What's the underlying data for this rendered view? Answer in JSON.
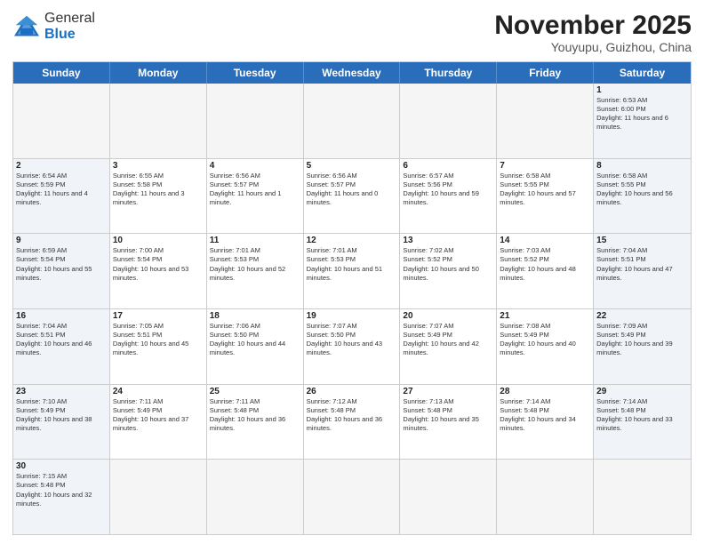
{
  "header": {
    "logo_general": "General",
    "logo_blue": "Blue",
    "month_title": "November 2025",
    "location": "Youyupu, Guizhou, China"
  },
  "calendar": {
    "days": [
      "Sunday",
      "Monday",
      "Tuesday",
      "Wednesday",
      "Thursday",
      "Friday",
      "Saturday"
    ],
    "rows": [
      [
        {
          "day": "",
          "empty": true
        },
        {
          "day": "",
          "empty": true
        },
        {
          "day": "",
          "empty": true
        },
        {
          "day": "",
          "empty": true
        },
        {
          "day": "",
          "empty": true
        },
        {
          "day": "",
          "empty": true
        },
        {
          "day": "1",
          "sunrise": "6:53 AM",
          "sunset": "6:00 PM",
          "daylight": "11 hours and 6 minutes.",
          "weekend": true
        }
      ],
      [
        {
          "day": "2",
          "sunrise": "6:54 AM",
          "sunset": "5:59 PM",
          "daylight": "11 hours and 4 minutes.",
          "weekend": true
        },
        {
          "day": "3",
          "sunrise": "6:55 AM",
          "sunset": "5:58 PM",
          "daylight": "11 hours and 3 minutes.",
          "weekend": false
        },
        {
          "day": "4",
          "sunrise": "6:56 AM",
          "sunset": "5:57 PM",
          "daylight": "11 hours and 1 minute.",
          "weekend": false
        },
        {
          "day": "5",
          "sunrise": "6:56 AM",
          "sunset": "5:57 PM",
          "daylight": "11 hours and 0 minutes.",
          "weekend": false
        },
        {
          "day": "6",
          "sunrise": "6:57 AM",
          "sunset": "5:56 PM",
          "daylight": "10 hours and 59 minutes.",
          "weekend": false
        },
        {
          "day": "7",
          "sunrise": "6:58 AM",
          "sunset": "5:55 PM",
          "daylight": "10 hours and 57 minutes.",
          "weekend": false
        },
        {
          "day": "8",
          "sunrise": "6:58 AM",
          "sunset": "5:55 PM",
          "daylight": "10 hours and 56 minutes.",
          "weekend": true
        }
      ],
      [
        {
          "day": "9",
          "sunrise": "6:59 AM",
          "sunset": "5:54 PM",
          "daylight": "10 hours and 55 minutes.",
          "weekend": true
        },
        {
          "day": "10",
          "sunrise": "7:00 AM",
          "sunset": "5:54 PM",
          "daylight": "10 hours and 53 minutes.",
          "weekend": false
        },
        {
          "day": "11",
          "sunrise": "7:01 AM",
          "sunset": "5:53 PM",
          "daylight": "10 hours and 52 minutes.",
          "weekend": false
        },
        {
          "day": "12",
          "sunrise": "7:01 AM",
          "sunset": "5:53 PM",
          "daylight": "10 hours and 51 minutes.",
          "weekend": false
        },
        {
          "day": "13",
          "sunrise": "7:02 AM",
          "sunset": "5:52 PM",
          "daylight": "10 hours and 50 minutes.",
          "weekend": false
        },
        {
          "day": "14",
          "sunrise": "7:03 AM",
          "sunset": "5:52 PM",
          "daylight": "10 hours and 48 minutes.",
          "weekend": false
        },
        {
          "day": "15",
          "sunrise": "7:04 AM",
          "sunset": "5:51 PM",
          "daylight": "10 hours and 47 minutes.",
          "weekend": true
        }
      ],
      [
        {
          "day": "16",
          "sunrise": "7:04 AM",
          "sunset": "5:51 PM",
          "daylight": "10 hours and 46 minutes.",
          "weekend": true
        },
        {
          "day": "17",
          "sunrise": "7:05 AM",
          "sunset": "5:51 PM",
          "daylight": "10 hours and 45 minutes.",
          "weekend": false
        },
        {
          "day": "18",
          "sunrise": "7:06 AM",
          "sunset": "5:50 PM",
          "daylight": "10 hours and 44 minutes.",
          "weekend": false
        },
        {
          "day": "19",
          "sunrise": "7:07 AM",
          "sunset": "5:50 PM",
          "daylight": "10 hours and 43 minutes.",
          "weekend": false
        },
        {
          "day": "20",
          "sunrise": "7:07 AM",
          "sunset": "5:49 PM",
          "daylight": "10 hours and 42 minutes.",
          "weekend": false
        },
        {
          "day": "21",
          "sunrise": "7:08 AM",
          "sunset": "5:49 PM",
          "daylight": "10 hours and 40 minutes.",
          "weekend": false
        },
        {
          "day": "22",
          "sunrise": "7:09 AM",
          "sunset": "5:49 PM",
          "daylight": "10 hours and 39 minutes.",
          "weekend": true
        }
      ],
      [
        {
          "day": "23",
          "sunrise": "7:10 AM",
          "sunset": "5:49 PM",
          "daylight": "10 hours and 38 minutes.",
          "weekend": true
        },
        {
          "day": "24",
          "sunrise": "7:11 AM",
          "sunset": "5:49 PM",
          "daylight": "10 hours and 37 minutes.",
          "weekend": false
        },
        {
          "day": "25",
          "sunrise": "7:11 AM",
          "sunset": "5:48 PM",
          "daylight": "10 hours and 36 minutes.",
          "weekend": false
        },
        {
          "day": "26",
          "sunrise": "7:12 AM",
          "sunset": "5:48 PM",
          "daylight": "10 hours and 36 minutes.",
          "weekend": false
        },
        {
          "day": "27",
          "sunrise": "7:13 AM",
          "sunset": "5:48 PM",
          "daylight": "10 hours and 35 minutes.",
          "weekend": false
        },
        {
          "day": "28",
          "sunrise": "7:14 AM",
          "sunset": "5:48 PM",
          "daylight": "10 hours and 34 minutes.",
          "weekend": false
        },
        {
          "day": "29",
          "sunrise": "7:14 AM",
          "sunset": "5:48 PM",
          "daylight": "10 hours and 33 minutes.",
          "weekend": true
        }
      ],
      [
        {
          "day": "30",
          "sunrise": "7:15 AM",
          "sunset": "5:48 PM",
          "daylight": "10 hours and 32 minutes.",
          "weekend": true
        },
        {
          "day": "",
          "empty": true
        },
        {
          "day": "",
          "empty": true
        },
        {
          "day": "",
          "empty": true
        },
        {
          "day": "",
          "empty": true
        },
        {
          "day": "",
          "empty": true
        },
        {
          "day": "",
          "empty": true
        }
      ]
    ]
  },
  "labels": {
    "sunrise_prefix": "Sunrise: ",
    "sunset_prefix": "Sunset: ",
    "daylight_prefix": "Daylight: "
  }
}
